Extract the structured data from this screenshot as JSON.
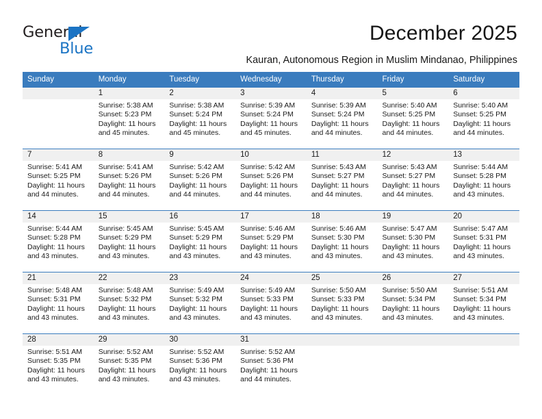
{
  "brand": {
    "name_top": "General",
    "name_bottom": "Blue",
    "triangle_color": "#1b74c4",
    "text_color": "#231f20"
  },
  "header": {
    "month_title": "December 2025",
    "location_subtitle": "Kauran, Autonomous Region in Muslim Mindanao, Philippines"
  },
  "theme": {
    "header_blue": "#3a7cbe",
    "band_gray": "#f0f0f0",
    "text": "#1a1a1a"
  },
  "calendar": {
    "weekday_headers": [
      "Sunday",
      "Monday",
      "Tuesday",
      "Wednesday",
      "Thursday",
      "Friday",
      "Saturday"
    ],
    "weeks": [
      [
        {
          "day": "",
          "sunrise": "",
          "sunset": "",
          "daylight_line1": "",
          "daylight_line2": ""
        },
        {
          "day": "1",
          "sunrise": "Sunrise: 5:38 AM",
          "sunset": "Sunset: 5:23 PM",
          "daylight_line1": "Daylight: 11 hours",
          "daylight_line2": "and 45 minutes."
        },
        {
          "day": "2",
          "sunrise": "Sunrise: 5:38 AM",
          "sunset": "Sunset: 5:24 PM",
          "daylight_line1": "Daylight: 11 hours",
          "daylight_line2": "and 45 minutes."
        },
        {
          "day": "3",
          "sunrise": "Sunrise: 5:39 AM",
          "sunset": "Sunset: 5:24 PM",
          "daylight_line1": "Daylight: 11 hours",
          "daylight_line2": "and 45 minutes."
        },
        {
          "day": "4",
          "sunrise": "Sunrise: 5:39 AM",
          "sunset": "Sunset: 5:24 PM",
          "daylight_line1": "Daylight: 11 hours",
          "daylight_line2": "and 44 minutes."
        },
        {
          "day": "5",
          "sunrise": "Sunrise: 5:40 AM",
          "sunset": "Sunset: 5:25 PM",
          "daylight_line1": "Daylight: 11 hours",
          "daylight_line2": "and 44 minutes."
        },
        {
          "day": "6",
          "sunrise": "Sunrise: 5:40 AM",
          "sunset": "Sunset: 5:25 PM",
          "daylight_line1": "Daylight: 11 hours",
          "daylight_line2": "and 44 minutes."
        }
      ],
      [
        {
          "day": "7",
          "sunrise": "Sunrise: 5:41 AM",
          "sunset": "Sunset: 5:25 PM",
          "daylight_line1": "Daylight: 11 hours",
          "daylight_line2": "and 44 minutes."
        },
        {
          "day": "8",
          "sunrise": "Sunrise: 5:41 AM",
          "sunset": "Sunset: 5:26 PM",
          "daylight_line1": "Daylight: 11 hours",
          "daylight_line2": "and 44 minutes."
        },
        {
          "day": "9",
          "sunrise": "Sunrise: 5:42 AM",
          "sunset": "Sunset: 5:26 PM",
          "daylight_line1": "Daylight: 11 hours",
          "daylight_line2": "and 44 minutes."
        },
        {
          "day": "10",
          "sunrise": "Sunrise: 5:42 AM",
          "sunset": "Sunset: 5:26 PM",
          "daylight_line1": "Daylight: 11 hours",
          "daylight_line2": "and 44 minutes."
        },
        {
          "day": "11",
          "sunrise": "Sunrise: 5:43 AM",
          "sunset": "Sunset: 5:27 PM",
          "daylight_line1": "Daylight: 11 hours",
          "daylight_line2": "and 44 minutes."
        },
        {
          "day": "12",
          "sunrise": "Sunrise: 5:43 AM",
          "sunset": "Sunset: 5:27 PM",
          "daylight_line1": "Daylight: 11 hours",
          "daylight_line2": "and 44 minutes."
        },
        {
          "day": "13",
          "sunrise": "Sunrise: 5:44 AM",
          "sunset": "Sunset: 5:28 PM",
          "daylight_line1": "Daylight: 11 hours",
          "daylight_line2": "and 43 minutes."
        }
      ],
      [
        {
          "day": "14",
          "sunrise": "Sunrise: 5:44 AM",
          "sunset": "Sunset: 5:28 PM",
          "daylight_line1": "Daylight: 11 hours",
          "daylight_line2": "and 43 minutes."
        },
        {
          "day": "15",
          "sunrise": "Sunrise: 5:45 AM",
          "sunset": "Sunset: 5:29 PM",
          "daylight_line1": "Daylight: 11 hours",
          "daylight_line2": "and 43 minutes."
        },
        {
          "day": "16",
          "sunrise": "Sunrise: 5:45 AM",
          "sunset": "Sunset: 5:29 PM",
          "daylight_line1": "Daylight: 11 hours",
          "daylight_line2": "and 43 minutes."
        },
        {
          "day": "17",
          "sunrise": "Sunrise: 5:46 AM",
          "sunset": "Sunset: 5:29 PM",
          "daylight_line1": "Daylight: 11 hours",
          "daylight_line2": "and 43 minutes."
        },
        {
          "day": "18",
          "sunrise": "Sunrise: 5:46 AM",
          "sunset": "Sunset: 5:30 PM",
          "daylight_line1": "Daylight: 11 hours",
          "daylight_line2": "and 43 minutes."
        },
        {
          "day": "19",
          "sunrise": "Sunrise: 5:47 AM",
          "sunset": "Sunset: 5:30 PM",
          "daylight_line1": "Daylight: 11 hours",
          "daylight_line2": "and 43 minutes."
        },
        {
          "day": "20",
          "sunrise": "Sunrise: 5:47 AM",
          "sunset": "Sunset: 5:31 PM",
          "daylight_line1": "Daylight: 11 hours",
          "daylight_line2": "and 43 minutes."
        }
      ],
      [
        {
          "day": "21",
          "sunrise": "Sunrise: 5:48 AM",
          "sunset": "Sunset: 5:31 PM",
          "daylight_line1": "Daylight: 11 hours",
          "daylight_line2": "and 43 minutes."
        },
        {
          "day": "22",
          "sunrise": "Sunrise: 5:48 AM",
          "sunset": "Sunset: 5:32 PM",
          "daylight_line1": "Daylight: 11 hours",
          "daylight_line2": "and 43 minutes."
        },
        {
          "day": "23",
          "sunrise": "Sunrise: 5:49 AM",
          "sunset": "Sunset: 5:32 PM",
          "daylight_line1": "Daylight: 11 hours",
          "daylight_line2": "and 43 minutes."
        },
        {
          "day": "24",
          "sunrise": "Sunrise: 5:49 AM",
          "sunset": "Sunset: 5:33 PM",
          "daylight_line1": "Daylight: 11 hours",
          "daylight_line2": "and 43 minutes."
        },
        {
          "day": "25",
          "sunrise": "Sunrise: 5:50 AM",
          "sunset": "Sunset: 5:33 PM",
          "daylight_line1": "Daylight: 11 hours",
          "daylight_line2": "and 43 minutes."
        },
        {
          "day": "26",
          "sunrise": "Sunrise: 5:50 AM",
          "sunset": "Sunset: 5:34 PM",
          "daylight_line1": "Daylight: 11 hours",
          "daylight_line2": "and 43 minutes."
        },
        {
          "day": "27",
          "sunrise": "Sunrise: 5:51 AM",
          "sunset": "Sunset: 5:34 PM",
          "daylight_line1": "Daylight: 11 hours",
          "daylight_line2": "and 43 minutes."
        }
      ],
      [
        {
          "day": "28",
          "sunrise": "Sunrise: 5:51 AM",
          "sunset": "Sunset: 5:35 PM",
          "daylight_line1": "Daylight: 11 hours",
          "daylight_line2": "and 43 minutes."
        },
        {
          "day": "29",
          "sunrise": "Sunrise: 5:52 AM",
          "sunset": "Sunset: 5:35 PM",
          "daylight_line1": "Daylight: 11 hours",
          "daylight_line2": "and 43 minutes."
        },
        {
          "day": "30",
          "sunrise": "Sunrise: 5:52 AM",
          "sunset": "Sunset: 5:36 PM",
          "daylight_line1": "Daylight: 11 hours",
          "daylight_line2": "and 43 minutes."
        },
        {
          "day": "31",
          "sunrise": "Sunrise: 5:52 AM",
          "sunset": "Sunset: 5:36 PM",
          "daylight_line1": "Daylight: 11 hours",
          "daylight_line2": "and 44 minutes."
        },
        {
          "day": "",
          "sunrise": "",
          "sunset": "",
          "daylight_line1": "",
          "daylight_line2": ""
        },
        {
          "day": "",
          "sunrise": "",
          "sunset": "",
          "daylight_line1": "",
          "daylight_line2": ""
        },
        {
          "day": "",
          "sunrise": "",
          "sunset": "",
          "daylight_line1": "",
          "daylight_line2": ""
        }
      ]
    ]
  }
}
